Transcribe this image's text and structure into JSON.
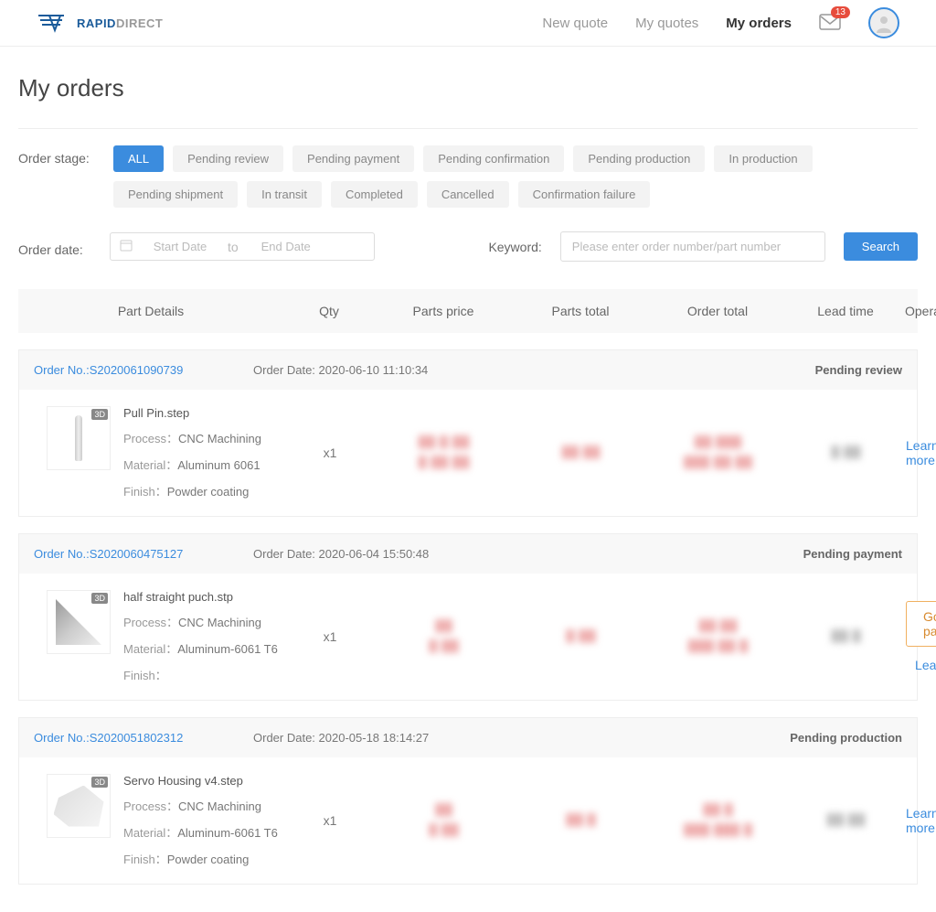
{
  "header": {
    "logo_text_a": "RAPID",
    "logo_text_b": "DIRECT",
    "nav": {
      "new_quote": "New quote",
      "my_quotes": "My quotes",
      "my_orders": "My orders"
    },
    "mail_badge": "13"
  },
  "page": {
    "title": "My orders"
  },
  "filters": {
    "stage_label": "Order stage:",
    "stages": [
      "ALL",
      "Pending review",
      "Pending payment",
      "Pending confirmation",
      "Pending production",
      "In production",
      "Pending shipment",
      "In transit",
      "Completed",
      "Cancelled",
      "Confirmation failure"
    ],
    "date_label": "Order date:",
    "start_placeholder": "Start Date",
    "to_label": "to",
    "end_placeholder": "End Date",
    "keyword_label": "Keyword:",
    "keyword_placeholder": "Please enter order number/part number",
    "search_btn": "Search"
  },
  "columns": {
    "part_details": "Part Details",
    "qty": "Qty",
    "parts_price": "Parts price",
    "parts_total": "Parts total",
    "order_total": "Order total",
    "lead_time": "Lead time",
    "operate": "Operate"
  },
  "labels": {
    "order_no_prefix": "Order No.:",
    "order_date_prefix": "Order Date: ",
    "process": "Process：",
    "material": "Material：",
    "finish": "Finish：",
    "learn_more": "Learn more",
    "go_to_payment": "Go to payment",
    "tag3d": "3D"
  },
  "orders": [
    {
      "order_no": "S2020061090739",
      "order_date": "2020-06-10 11:10:34",
      "status": "Pending review",
      "part_name": "Pull Pin.step",
      "process": "CNC Machining",
      "material": "Aluminum 6061",
      "finish": "Powder coating",
      "qty": "x1",
      "actions": [
        "learn_more"
      ]
    },
    {
      "order_no": "S2020060475127",
      "order_date": "2020-06-04 15:50:48",
      "status": "Pending payment",
      "part_name": "half straight puch.stp",
      "process": "CNC Machining",
      "material": "Aluminum-6061 T6",
      "finish": "",
      "qty": "x1",
      "actions": [
        "go_to_payment",
        "learn_more"
      ]
    },
    {
      "order_no": "S2020051802312",
      "order_date": "2020-05-18 18:14:27",
      "status": "Pending production",
      "part_name": "Servo Housing v4.step",
      "process": "CNC Machining",
      "material": "Aluminum-6061 T6",
      "finish": "Powder coating",
      "qty": "x1",
      "actions": [
        "learn_more"
      ]
    }
  ]
}
